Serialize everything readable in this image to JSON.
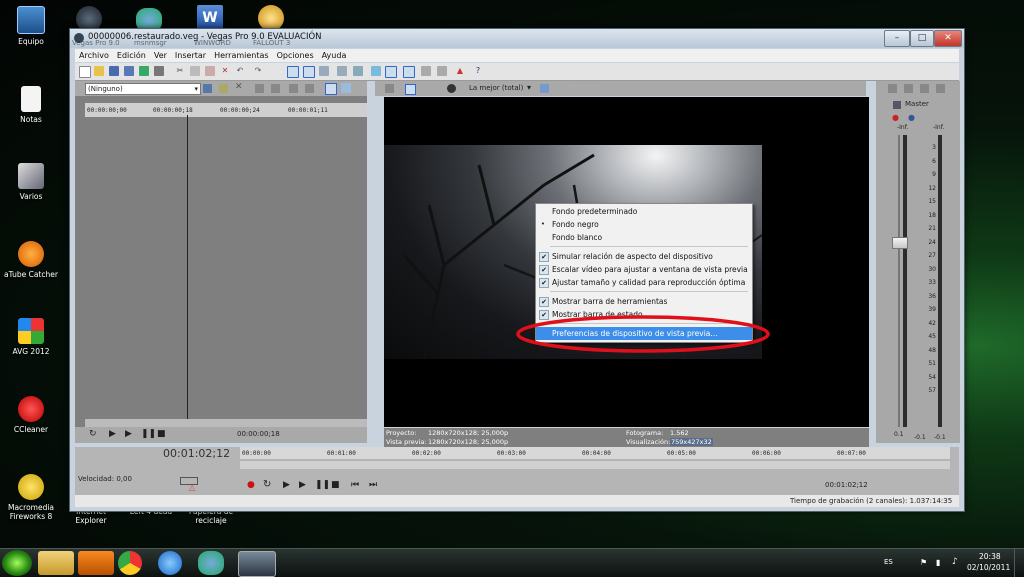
{
  "desktop": {
    "icons": [
      {
        "label": "Equipo"
      },
      {
        "label": "Notas"
      },
      {
        "label": "Varios"
      },
      {
        "label": "aTube Catcher"
      },
      {
        "label": "AVG 2012"
      },
      {
        "label": "CCleaner"
      },
      {
        "label": "Macromedia Fireworks 8"
      },
      {
        "label": "Internet Explorer"
      },
      {
        "label": "Left 4 dead"
      },
      {
        "label": "Papelera de reciclaje"
      }
    ],
    "top_icon_labels": [
      "Vegas Pro 9.0",
      "msnmsgr",
      "WINWORD",
      "FALLOUT 3"
    ]
  },
  "window": {
    "title": "00000006.restaurado.veg - Vegas Pro 9.0 EVALUACIÓN",
    "controls": {
      "minimize": "–",
      "maximize": "□",
      "close": "✕"
    }
  },
  "menubar": [
    "Archivo",
    "Edición",
    "Ver",
    "Insertar",
    "Herramientas",
    "Opciones",
    "Ayuda"
  ],
  "trimmer": {
    "dropdown_value": "(Ninguno)",
    "ruler_ticks": [
      "00:00:00;00",
      "00:00:00;18",
      "00:00:00;24",
      "00:00:01;11"
    ],
    "timecode": "00:00:00;18"
  },
  "preview": {
    "quality": "La mejor (total)",
    "proyecto_label": "Proyecto:",
    "proyecto_value": "1280x720x128; 25,000p",
    "vista_label": "Vista previa:",
    "vista_value": "1280x720x128; 25,000p",
    "fotograma_label": "Fotograma:",
    "fotograma_value": "1.562",
    "visualizacion_label": "Visualización:",
    "visualizacion_value": "759x427x32"
  },
  "context_menu": {
    "items": [
      {
        "label": "Fondo predeterminado",
        "mark": ""
      },
      {
        "label": "Fondo negro",
        "mark": "•"
      },
      {
        "label": "Fondo blanco",
        "mark": ""
      },
      {
        "label": "Simular relación de aspecto del dispositivo",
        "mark": "✔"
      },
      {
        "label": "Escalar vídeo para ajustar a ventana de vista previa",
        "mark": "✔"
      },
      {
        "label": "Ajustar tamaño y calidad para reproducción óptima",
        "mark": "✔"
      },
      {
        "label": "Mostrar barra de herramientas",
        "mark": "✔"
      },
      {
        "label": "Mostrar barra de estado",
        "mark": "✔"
      },
      {
        "label": "Preferencias de dispositivo de vista previa...",
        "mark": ""
      }
    ],
    "highlight_color": "#3d8ee8",
    "annotation_color": "#e0101a"
  },
  "mixer": {
    "title": "Master",
    "peak_left": "-Inf.",
    "peak_right": "-Inf.",
    "db_scale": [
      "3",
      "6",
      "9",
      "12",
      "15",
      "18",
      "21",
      "24",
      "27",
      "30",
      "33",
      "36",
      "39",
      "42",
      "45",
      "48",
      "51",
      "54",
      "57"
    ],
    "fader_left": "0.1",
    "fader_right": "0.1",
    "level_left": "-0.1",
    "level_right": "-0.1"
  },
  "timeline": {
    "position": "00:01:02;12",
    "ruler_ticks": [
      "00:00:00",
      "00:01:00",
      "00:02:00",
      "00:03:00",
      "00:04:00",
      "00:05:00",
      "00:06:00",
      "00:07:00"
    ],
    "velocidad": "Velocidad: 0,00",
    "transport_time": "00:01:02;12",
    "status": "Tiempo de grabación (2 canales): 1.037:14:35"
  },
  "taskbar": {
    "language": "ES",
    "time": "20:38",
    "date": "02/10/2011"
  }
}
